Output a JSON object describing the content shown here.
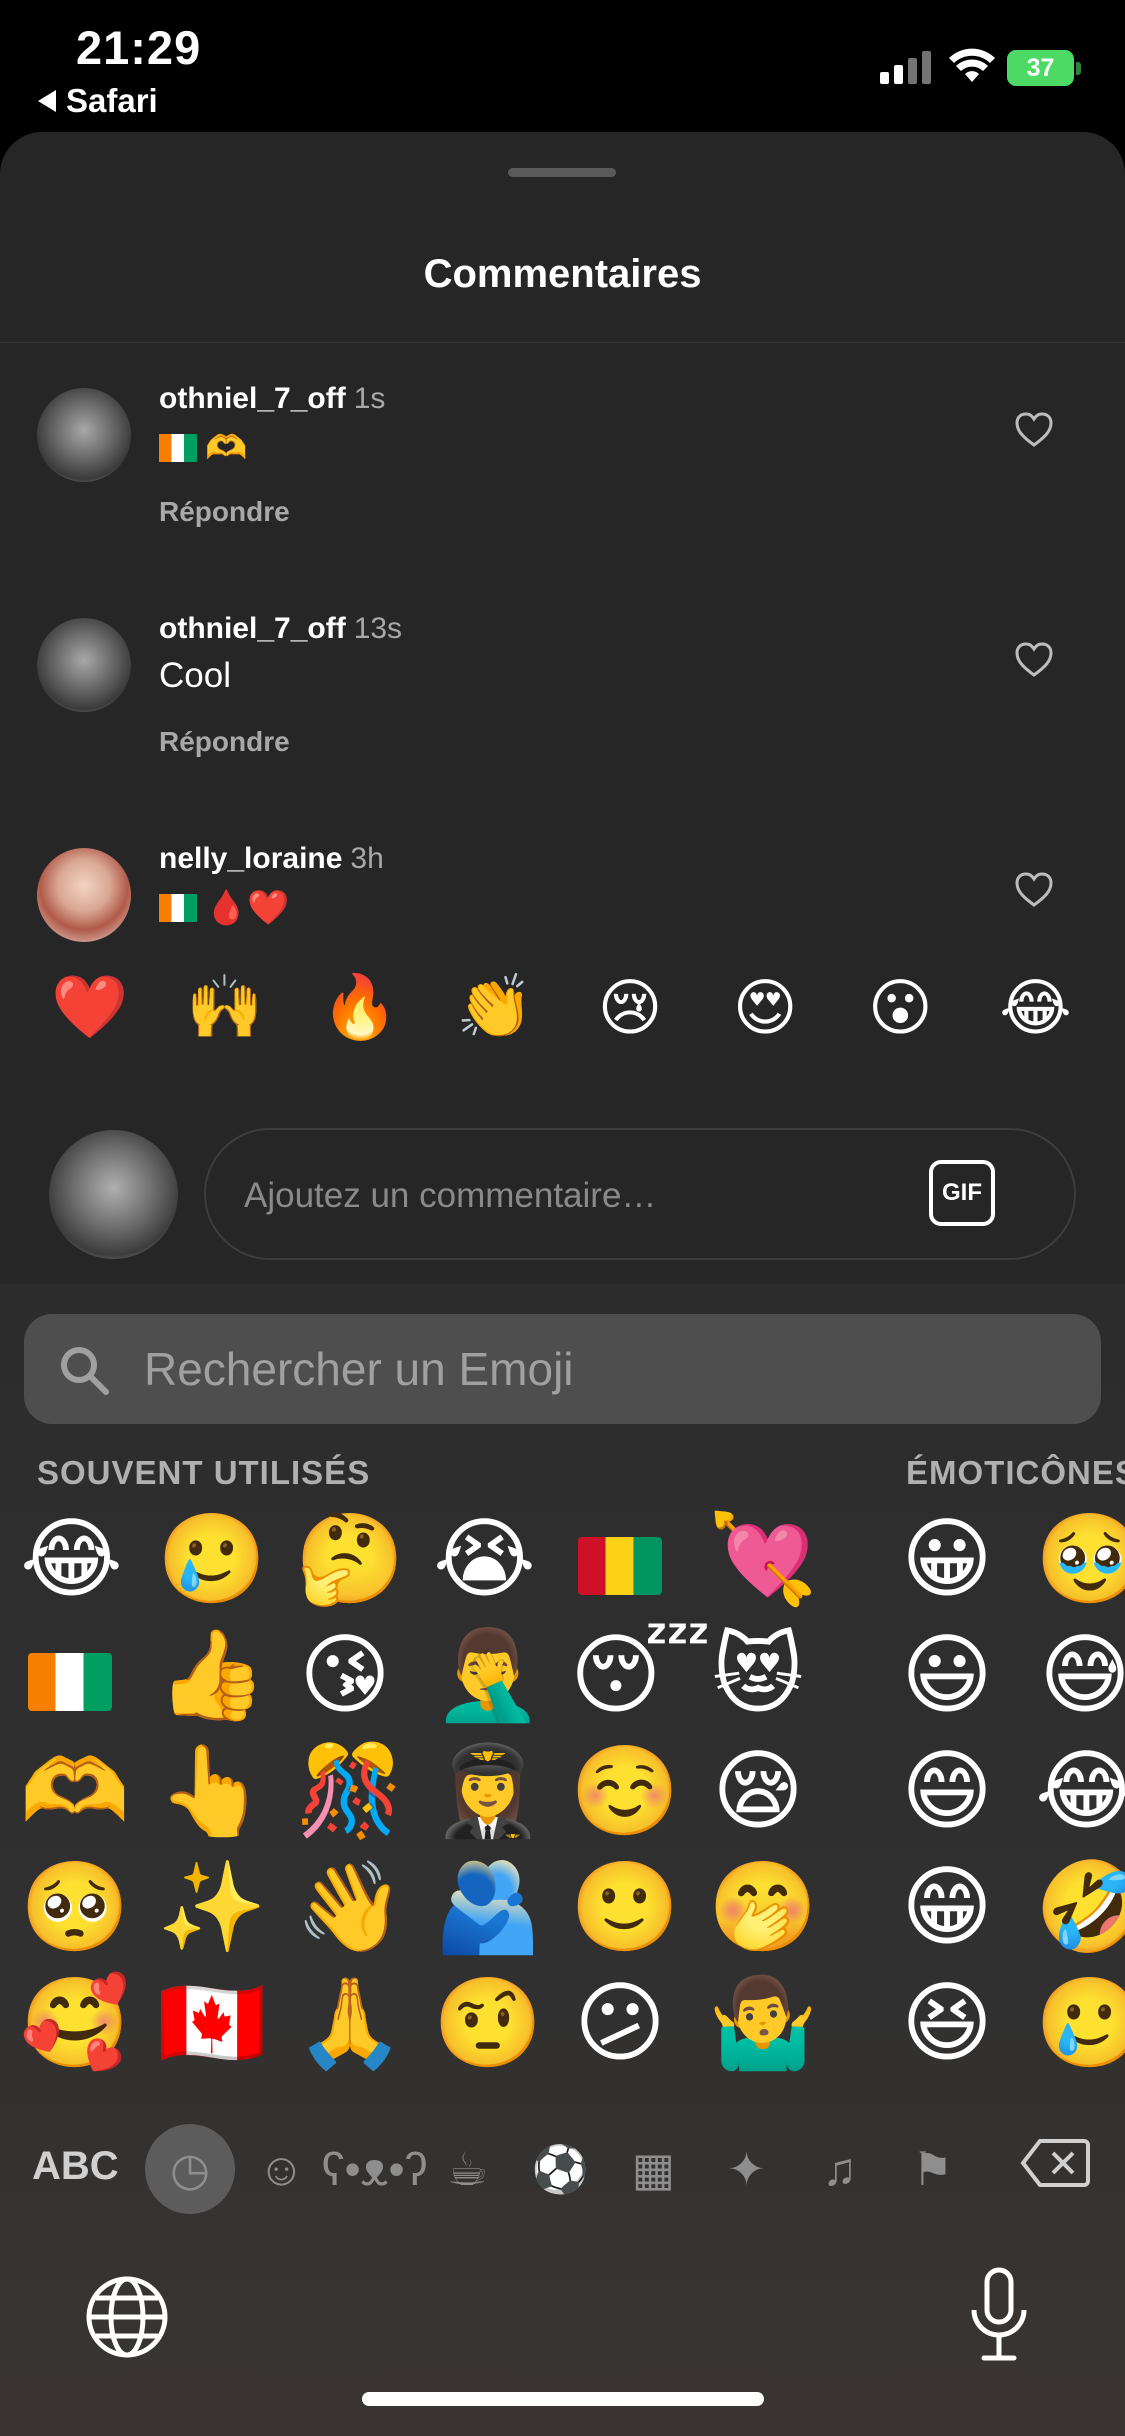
{
  "status_bar": {
    "time": "21:29",
    "back_label": "Safari",
    "battery": "37"
  },
  "sheet": {
    "title": "Commentaires"
  },
  "comments": [
    {
      "user": "othniel_7_off",
      "time": "1s",
      "text": "🫶",
      "reply": "Répondre"
    },
    {
      "user": "othniel_7_off",
      "time": "13s",
      "text": "Cool",
      "reply": "Répondre"
    },
    {
      "user": "nelly_loraine",
      "time": "3h",
      "text": "🩸❤️",
      "reply": ""
    }
  ],
  "reactions": [
    "❤️",
    "🙌",
    "🔥",
    "👏",
    "😢",
    "😍",
    "😮",
    "😂"
  ],
  "comment_input": {
    "placeholder": "Ajoutez un commentaire…",
    "gif_label": "GIF"
  },
  "keyboard": {
    "search_placeholder": "Rechercher un Emoji",
    "section_frequent": "SOUVENT UTILISÉS",
    "section_smileys": "ÉMOTICÔNES",
    "abc_label": "ABC",
    "frequent": [
      [
        "😂",
        "🥲",
        "🤔",
        "😭",
        "flag-gn",
        "💘"
      ],
      [
        "flag-ci",
        "👍",
        "😘",
        "🤦‍♂️",
        "😴",
        "😻"
      ],
      [
        "🫶",
        "👆",
        "🎊",
        "👩‍✈️",
        "☺️",
        "😪"
      ],
      [
        "🥺",
        "✨",
        "👋",
        "🫂",
        "🙂",
        "🤭"
      ],
      [
        "🥰",
        "🇨🇦",
        "🙏",
        "🤨",
        "😕",
        "🤷‍♂️"
      ]
    ],
    "smileys": [
      [
        "😀",
        "🥹"
      ],
      [
        "😃",
        "😅"
      ],
      [
        "😄",
        "😂"
      ],
      [
        "😁",
        "🤣"
      ],
      [
        "😆",
        "🥲"
      ]
    ],
    "categories": [
      "clock-icon",
      "smiley-icon",
      "bear-icon",
      "food-icon",
      "ball-icon",
      "building-icon",
      "bulb-icon",
      "symbols-icon",
      "flag-icon"
    ]
  },
  "colors": {
    "sheet_bg": "#262626",
    "keyboard_bg": "#2c2c2c",
    "battery_green": "#4cd964"
  }
}
